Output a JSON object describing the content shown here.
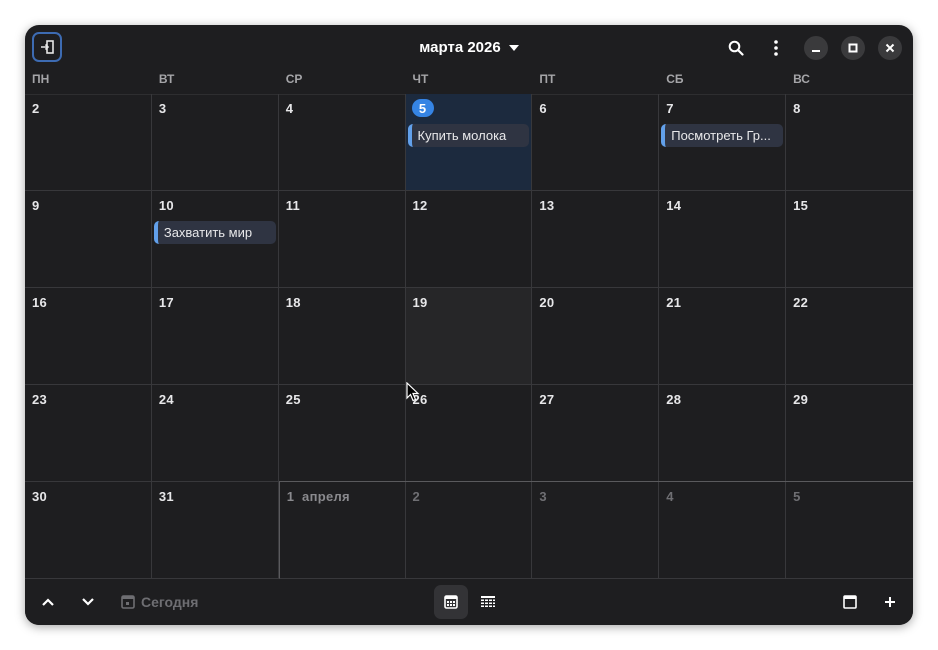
{
  "header": {
    "title": "марта 2026",
    "icons": {
      "sidebar": "sidebar-toggle-icon",
      "dropdown": "chevron-down-icon",
      "search": "search-icon",
      "menu": "vertical-dots-icon",
      "minimize": "minimize-icon",
      "maximize": "maximize-icon",
      "close": "close-icon"
    }
  },
  "weekdays": [
    "ПН",
    "ВТ",
    "СР",
    "ЧТ",
    "ПТ",
    "СБ",
    "ВС"
  ],
  "weeks": [
    [
      {
        "label": "2"
      },
      {
        "label": "3"
      },
      {
        "label": "4"
      },
      {
        "label": "5",
        "today": true,
        "event": "Купить молока"
      },
      {
        "label": "6"
      },
      {
        "label": "7",
        "event": "Посмотреть Гр..."
      },
      {
        "label": "8"
      }
    ],
    [
      {
        "label": "9"
      },
      {
        "label": "10",
        "event": "Захватить мир"
      },
      {
        "label": "11"
      },
      {
        "label": "12"
      },
      {
        "label": "13"
      },
      {
        "label": "14"
      },
      {
        "label": "15"
      }
    ],
    [
      {
        "label": "16"
      },
      {
        "label": "17"
      },
      {
        "label": "18"
      },
      {
        "label": "19",
        "hover": true
      },
      {
        "label": "20"
      },
      {
        "label": "21"
      },
      {
        "label": "22"
      }
    ],
    [
      {
        "label": "23"
      },
      {
        "label": "24"
      },
      {
        "label": "25"
      },
      {
        "label": "26"
      },
      {
        "label": "27"
      },
      {
        "label": "28"
      },
      {
        "label": "29"
      }
    ],
    [
      {
        "label": "30"
      },
      {
        "label": "31"
      },
      {
        "label": "1  апреля",
        "next_month": true,
        "first": true
      },
      {
        "label": "2",
        "next_month": true
      },
      {
        "label": "3",
        "next_month": true
      },
      {
        "label": "4",
        "next_month": true
      },
      {
        "label": "5",
        "next_month": true
      }
    ]
  ],
  "bottombar": {
    "today_label": "Сегодня",
    "icons": {
      "prev": "chevron-up-icon",
      "next": "chevron-down-icon",
      "today": "calendar-today-icon",
      "month_view": "month-view-icon",
      "list_view": "list-view-icon",
      "day_view": "day-view-icon",
      "add": "add-icon"
    }
  },
  "colors": {
    "accent": "#3584e4",
    "event_stripe": "#62a0ea",
    "window_bg": "#1e1e20",
    "today_bg": "#1c2a3e"
  }
}
